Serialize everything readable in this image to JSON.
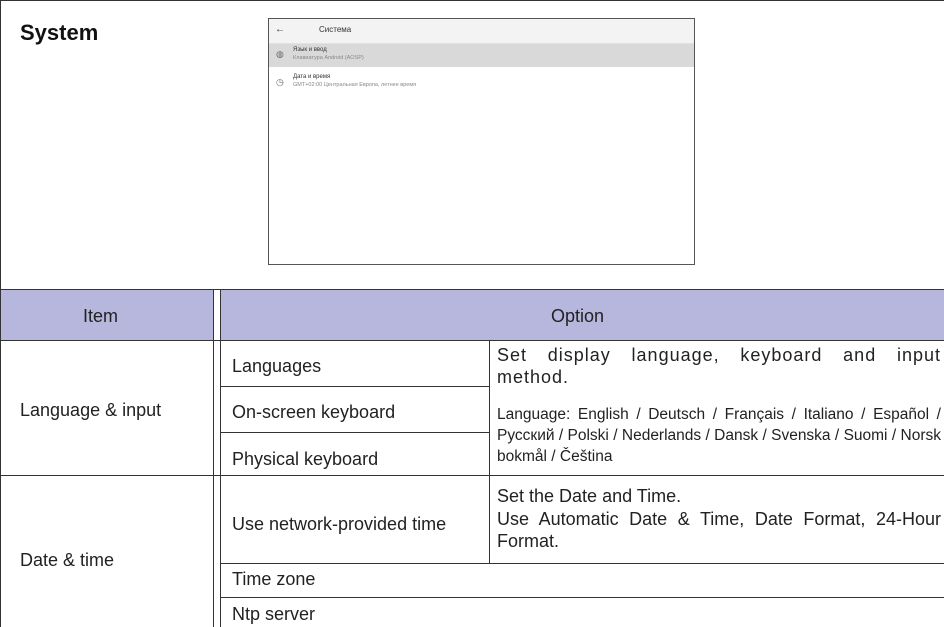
{
  "title": "System",
  "screenshot": {
    "back": "←",
    "header": "Система",
    "items": [
      {
        "icon": "language-icon",
        "label": "Язык и ввод",
        "sub": "Клавиатура Android (AOSP)"
      },
      {
        "icon": "clock-icon",
        "label": "Дата и время",
        "sub": "GMT+02:00 Центральная Европа, летнее время"
      }
    ]
  },
  "table": {
    "header": {
      "item": "Item",
      "option": "Option"
    },
    "sections": [
      {
        "item": "Language & input",
        "options": [
          "Languages",
          "On-screen keyboard",
          "Physical keyboard"
        ],
        "desc_1": "Set display language, keyboard and input method.",
        "desc_2": "Language: English / Deutsch / Français / Italiano / Español / Русский / Polski / Nederlands / Dansk / Svenska / Suomi / Norsk bokmål / Čeština"
      },
      {
        "item": "Date & time",
        "options": [
          "Use network-provided time",
          "Time zone",
          "Ntp server"
        ],
        "desc_1": "Set the Date and Time.",
        "desc_2": "Use Automatic Date & Time, Date Format, 24-Hour Format."
      }
    ]
  }
}
